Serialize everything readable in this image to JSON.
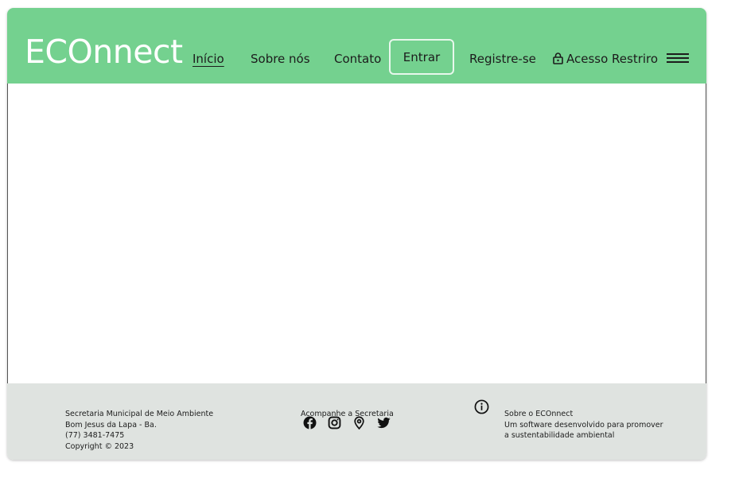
{
  "header": {
    "brand": "ECOnnect",
    "nav": {
      "inicio": "Início",
      "sobre": "Sobre nós",
      "contato": "Contato",
      "entrar": "Entrar",
      "registre": "Registre-se",
      "acesso": "Acesso Restriro"
    },
    "icons": {
      "lock": "lock-icon",
      "menu": "hamburger-menu-icon"
    },
    "colors": {
      "header_bg": "#74d18f",
      "footer_bg": "#dfe3e0"
    }
  },
  "footer": {
    "address": {
      "line1": "Secretaria Municipal de Meio Ambiente",
      "line2": "Bom Jesus da Lapa - Ba.",
      "line3": "(77) 3481-7475",
      "line4": "Copyright © 2023"
    },
    "social": {
      "title": "Acompanhe a Secretaria",
      "icons": [
        "facebook-icon",
        "instagram-icon",
        "location-pin-icon",
        "twitter-icon"
      ]
    },
    "about": {
      "line1": "Sobre o ECOnnect",
      "line2": "Um software desenvolvido para promover",
      "line3": "a sustentabilidade ambiental"
    }
  }
}
